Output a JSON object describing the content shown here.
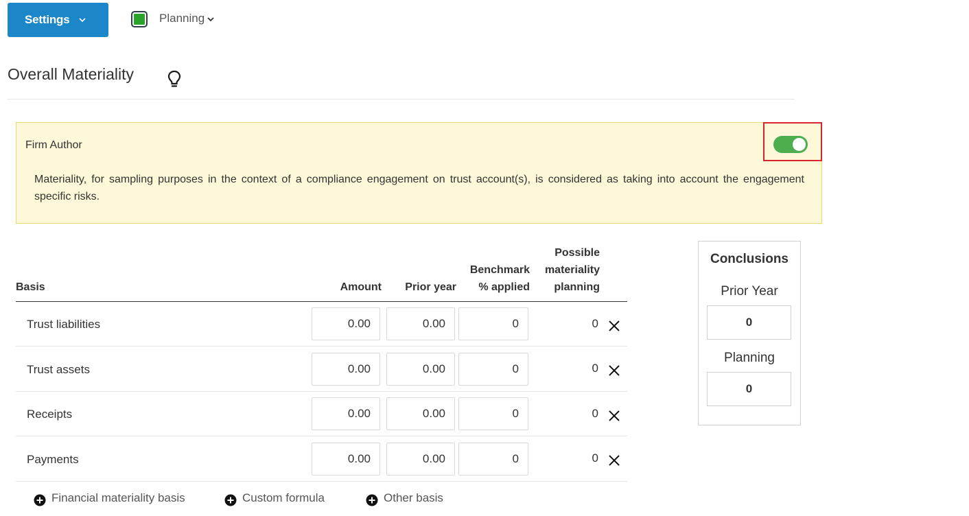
{
  "toolbar": {
    "settings_label": "Settings",
    "stage_label": "Planning",
    "status_color": "#2aa32a",
    "accent_color": "#1b87c9"
  },
  "heading": {
    "title": "Overall Materiality",
    "hint_icon": "lightbulb-icon"
  },
  "firm_author": {
    "label": "Firm Author",
    "toggle_on": true,
    "text": "Materiality, for sampling purposes in the context of a compliance engagement on trust account(s), is considered as taking into account the engagement specific risks."
  },
  "table": {
    "headers": {
      "basis": "Basis",
      "amount": "Amount",
      "prior_year": "Prior year",
      "benchmark": "Benchmark % applied",
      "possible": "Possible materiality planning"
    },
    "rows": [
      {
        "basis": "Trust liabilities",
        "amount": "0.00",
        "prior_year": "0.00",
        "benchmark": "0",
        "possible": "0"
      },
      {
        "basis": "Trust assets",
        "amount": "0.00",
        "prior_year": "0.00",
        "benchmark": "0",
        "possible": "0"
      },
      {
        "basis": "Receipts",
        "amount": "0.00",
        "prior_year": "0.00",
        "benchmark": "0",
        "possible": "0"
      },
      {
        "basis": "Payments",
        "amount": "0.00",
        "prior_year": "0.00",
        "benchmark": "0",
        "possible": "0"
      }
    ]
  },
  "add_options": [
    {
      "label": "Financial materiality basis"
    },
    {
      "label": "Custom formula"
    },
    {
      "label": "Other basis"
    }
  ],
  "conclusions": {
    "title": "Conclusions",
    "prior_year_label": "Prior Year",
    "prior_year_value": "0",
    "planning_label": "Planning",
    "planning_value": "0"
  }
}
